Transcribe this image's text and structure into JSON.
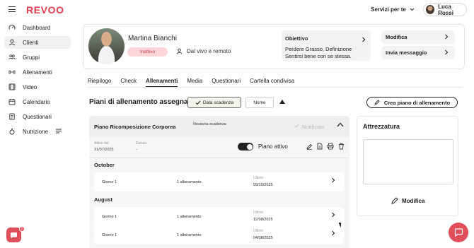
{
  "app": {
    "logo": "REVOO"
  },
  "header": {
    "services_label": "Servizi per te",
    "user_name": "Luca Rossi"
  },
  "sidebar": {
    "items": [
      {
        "label": "Dashboard",
        "icon": "gauge-icon"
      },
      {
        "label": "Clienti",
        "icon": "user-icon",
        "active": true
      },
      {
        "label": "Gruppi",
        "icon": "group-icon"
      },
      {
        "label": "Allenamenti",
        "icon": "dumbbell-icon"
      },
      {
        "label": "Video",
        "icon": "video-icon"
      },
      {
        "label": "Calendario",
        "icon": "calendar-icon"
      },
      {
        "label": "Questionari",
        "icon": "clipboard-icon"
      },
      {
        "label": "Nutrizione",
        "icon": "nutrition-icon"
      }
    ]
  },
  "client": {
    "name": "Martina Bianchi",
    "status": "Inattivo",
    "mode": "Dal vivo e remoto",
    "goal_title": "Obiettivo",
    "goal_text": "Perdere Grasso, Definizione Sentirsi bene con se stessa.",
    "edit_label": "Modifica",
    "message_label": "Invia messaggio"
  },
  "tabs": [
    "Riepilogo",
    "Check",
    "Allenamenti",
    "Media",
    "Questionari",
    "Cartella condivisa"
  ],
  "active_tab": "Allenamenti",
  "plans_section": {
    "title": "Piani di allenamento assegnati",
    "sort_date_label": "Data scadenza",
    "sort_name_label": "Nome",
    "create_label": "Crea piano di allenamento"
  },
  "plan": {
    "title": "Piano Ricomposizione Corporea",
    "expiry": "Nessuna scadenza",
    "notified_label": "Notificato",
    "active_since_label": "Attivo dal",
    "active_since_value": "31/07/2025",
    "duration_label": "Durata",
    "duration_value": "-",
    "toggle_label": "Piano attivo",
    "months": [
      {
        "name": "October",
        "days": [
          {
            "day": "Giorno 1",
            "count": "1 allenamento",
            "last_label": "Ultimo",
            "last_date": "09/10/2025"
          }
        ]
      },
      {
        "name": "August",
        "days": [
          {
            "day": "Giorno 1",
            "count": "1 allenamento",
            "last_label": "Ultimo",
            "last_date": "12/08/2025"
          },
          {
            "day": "Giorno 1",
            "count": "1 allenamento",
            "last_label": "Ultimo",
            "last_date": "04/08/2025"
          }
        ]
      }
    ]
  },
  "equipment": {
    "title": "Attrezzatura",
    "edit_label": "Modifica"
  },
  "chat": {
    "badge_count": "1"
  },
  "colors": {
    "accent": "#e53c4c",
    "badge_bg": "#fbd6d8",
    "dark": "#1f1f1f"
  }
}
